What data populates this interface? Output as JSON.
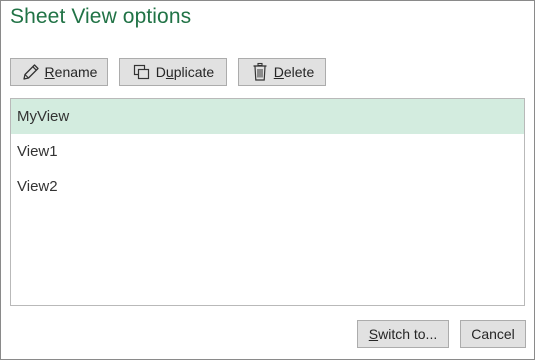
{
  "dialog": {
    "title": "Sheet View options"
  },
  "toolbar": {
    "rename": {
      "pre": "",
      "mnemonic": "R",
      "post": "ename",
      "icon": "pencil-icon"
    },
    "duplicate": {
      "pre": "D",
      "mnemonic": "u",
      "post": "plicate",
      "icon": "duplicate-icon"
    },
    "delete": {
      "pre": "",
      "mnemonic": "D",
      "post": "elete",
      "icon": "trash-icon"
    }
  },
  "views": {
    "items": [
      {
        "label": "MyView",
        "selected": true
      },
      {
        "label": "View1",
        "selected": false
      },
      {
        "label": "View2",
        "selected": false
      }
    ]
  },
  "footer": {
    "switch": {
      "pre": "",
      "mnemonic": "S",
      "post": "witch to..."
    },
    "cancel": {
      "label": "Cancel"
    }
  },
  "colors": {
    "title": "#217346",
    "selected_row": "#d3ecdf",
    "button_face": "#e1e1e1",
    "button_border": "#acacac"
  }
}
